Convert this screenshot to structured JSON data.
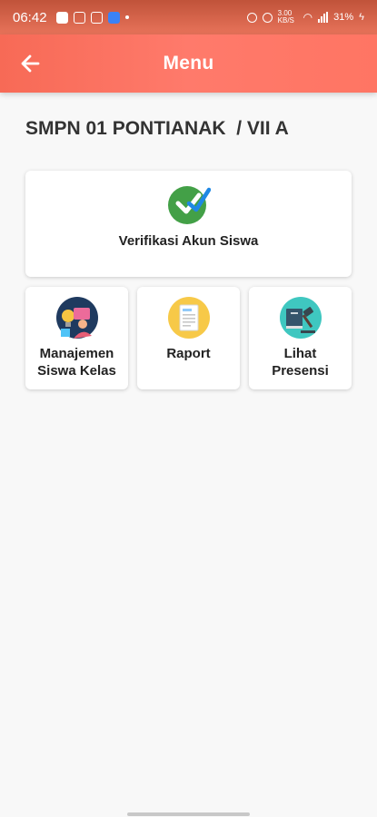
{
  "status_bar": {
    "time": "06:42",
    "battery": "31%",
    "net_speed": "3.00 KB/S"
  },
  "app_bar": {
    "title": "Menu",
    "back_icon": "arrow-left-icon"
  },
  "school_title": "SMPN 01 PONTIANAK  / VII A",
  "menu": {
    "verify": {
      "label": "Verifikasi Akun Siswa",
      "icon": "check-circle-icon"
    },
    "items": [
      {
        "label": "Manajemen\nSiswa Kelas",
        "icon": "students-icon"
      },
      {
        "label": "Raport",
        "icon": "document-icon"
      },
      {
        "label": "Lihat\nPresensi",
        "icon": "gavel-book-icon"
      }
    ]
  },
  "colors": {
    "header": "#ff7563",
    "check_green": "#43a047",
    "check_blue": "#1e88e5",
    "raport_yellow": "#f7c948",
    "presensi_teal": "#3fc7c0",
    "students_navy": "#1f3a5f"
  }
}
